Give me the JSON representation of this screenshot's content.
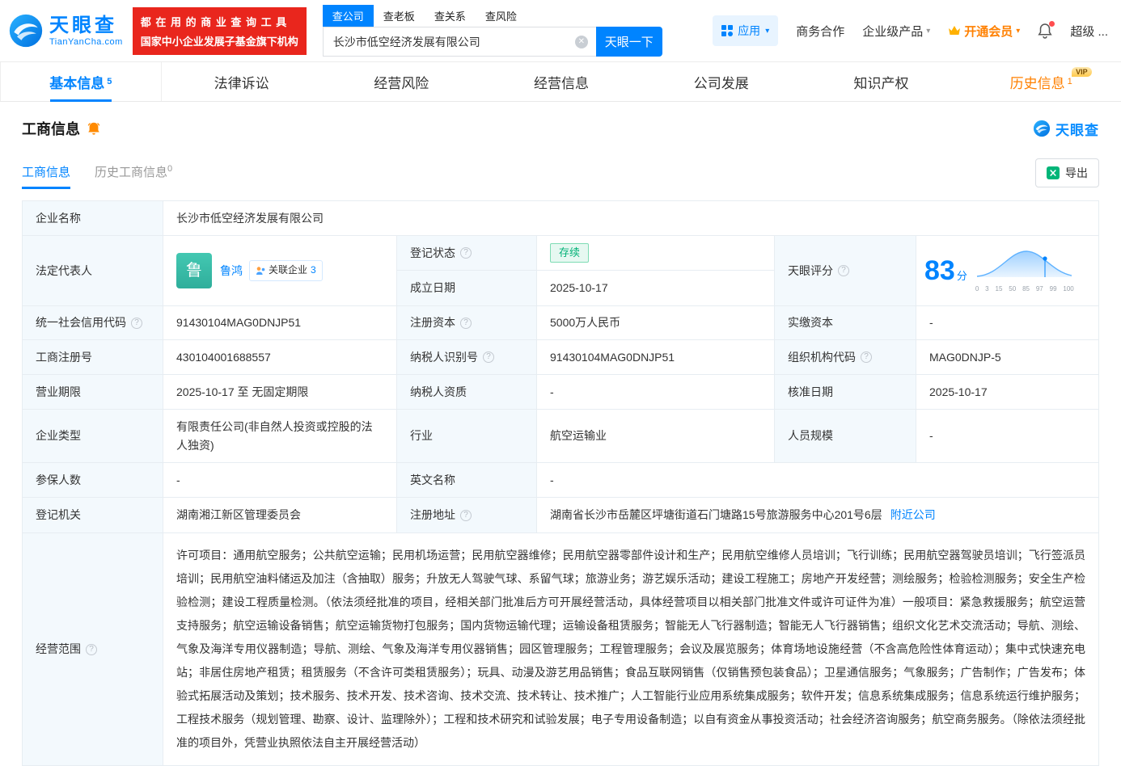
{
  "header": {
    "brand": {
      "name": "天眼查",
      "domain": "TianYanCha.com"
    },
    "promo": {
      "line1": "都 在 用 的 商 业 查 询 工 具",
      "line2": "国家中小企业发展子基金旗下机构"
    },
    "search_tabs": [
      "查公司",
      "查老板",
      "查关系",
      "查风险"
    ],
    "search": {
      "value": "长沙市低空经济发展有限公司",
      "button": "天眼一下"
    },
    "nav": {
      "apps": "应用",
      "biz_coop": "商务合作",
      "enterprise": "企业级产品",
      "vip": "开通会员",
      "super": "超级 ..."
    }
  },
  "tabs": [
    {
      "label": "基本信息",
      "count": "5"
    },
    {
      "label": "法律诉讼",
      "count": ""
    },
    {
      "label": "经营风险",
      "count": ""
    },
    {
      "label": "经营信息",
      "count": ""
    },
    {
      "label": "公司发展",
      "count": ""
    },
    {
      "label": "知识产权",
      "count": ""
    },
    {
      "label": "历史信息",
      "count": "1",
      "tag": "VIP"
    }
  ],
  "section": {
    "title": "工商信息",
    "brand_watermark": "天眼查",
    "subtabs": [
      {
        "label": "工商信息",
        "count": ""
      },
      {
        "label": "历史工商信息",
        "count": "0"
      }
    ],
    "export_label": "导出"
  },
  "fields": {
    "company_name": {
      "label": "企业名称",
      "value": "长沙市低空经济发展有限公司"
    },
    "legal_rep": {
      "label": "法定代表人",
      "avatar": "鲁",
      "name": "鲁鸿",
      "related_label": "关联企业",
      "related_count": "3"
    },
    "reg_status": {
      "label": "登记状态",
      "value": "存续"
    },
    "establish_date": {
      "label": "成立日期",
      "value": "2025-10-17"
    },
    "score": {
      "label": "天眼评分",
      "value": "83",
      "unit": "分",
      "axis": [
        "0",
        "3",
        "15",
        "50",
        "85",
        "97",
        "99",
        "100"
      ]
    },
    "credit_code": {
      "label": "统一社会信用代码",
      "value": "91430104MAG0DNJP51"
    },
    "reg_capital": {
      "label": "注册资本",
      "value": "5000万人民币"
    },
    "paid_capital": {
      "label": "实缴资本",
      "value": "-"
    },
    "reg_number": {
      "label": "工商注册号",
      "value": "430104001688557"
    },
    "taxpayer_id": {
      "label": "纳税人识别号",
      "value": "91430104MAG0DNJP51"
    },
    "org_code": {
      "label": "组织机构代码",
      "value": "MAG0DNJP-5"
    },
    "business_term": {
      "label": "营业期限",
      "value": "2025-10-17 至 无固定期限"
    },
    "taxpayer_quality": {
      "label": "纳税人资质",
      "value": "-"
    },
    "approval_date": {
      "label": "核准日期",
      "value": "2025-10-17"
    },
    "company_type": {
      "label": "企业类型",
      "value": "有限责任公司(非自然人投资或控股的法人独资)"
    },
    "industry": {
      "label": "行业",
      "value": "航空运输业"
    },
    "staff_size": {
      "label": "人员规模",
      "value": "-"
    },
    "insured_count": {
      "label": "参保人数",
      "value": "-"
    },
    "english_name": {
      "label": "英文名称",
      "value": "-"
    },
    "reg_authority": {
      "label": "登记机关",
      "value": "湖南湘江新区管理委员会"
    },
    "reg_address": {
      "label": "注册地址",
      "value": "湖南省长沙市岳麓区坪塘街道石门塘路15号旅游服务中心201号6层",
      "link": "附近公司"
    },
    "business_scope": {
      "label": "经营范围",
      "value": "许可项目：通用航空服务；公共航空运输；民用机场运营；民用航空器维修；民用航空器零部件设计和生产；民用航空维修人员培训；飞行训练；民用航空器驾驶员培训；飞行签派员培训；民用航空油料储运及加注（含抽取）服务；升放无人驾驶气球、系留气球；旅游业务；游艺娱乐活动；建设工程施工；房地产开发经营；测绘服务；检验检测服务；安全生产检验检测；建设工程质量检测。（依法须经批准的项目，经相关部门批准后方可开展经营活动，具体经营项目以相关部门批准文件或许可证件为准）一般项目：紧急救援服务；航空运营支持服务；航空运输设备销售；航空运输货物打包服务；国内货物运输代理；运输设备租赁服务；智能无人飞行器制造；智能无人飞行器销售；组织文化艺术交流活动；导航、测绘、气象及海洋专用仪器制造；导航、测绘、气象及海洋专用仪器销售；园区管理服务；工程管理服务；会议及展览服务；体育场地设施经营（不含高危险性体育运动）；集中式快速充电站；非居住房地产租赁；租赁服务（不含许可类租赁服务）；玩具、动漫及游艺用品销售；食品互联网销售（仅销售预包装食品）；卫星通信服务；气象服务；广告制作；广告发布；体验式拓展活动及策划；技术服务、技术开发、技术咨询、技术交流、技术转让、技术推广；人工智能行业应用系统集成服务；软件开发；信息系统集成服务；信息系统运行维护服务；工程技术服务（规划管理、勘察、设计、监理除外）；工程和技术研究和试验发展；电子专用设备制造；以自有资金从事投资活动；社会经济咨询服务；航空商务服务。（除依法须经批准的项目外，凭营业执照依法自主开展经营活动）"
    }
  }
}
